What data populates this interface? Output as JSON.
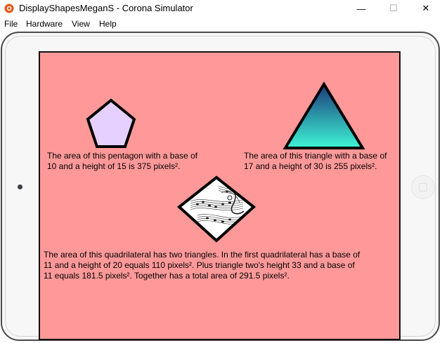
{
  "window": {
    "title": "DisplayShapesMeganS - Corona Simulator",
    "minimize_label": "—",
    "maximize_label": "☐",
    "close_label": "✕"
  },
  "menu": {
    "items": [
      "File",
      "Hardware",
      "View",
      "Help"
    ]
  },
  "screen": {
    "background_color": "#ff9999",
    "pentagon": {
      "fill": "#e6d0ff",
      "caption": "The area of this pentagon with a base of\n10 and a height of 15 is 375 pixels².",
      "base": 10,
      "height": 15,
      "area": 375
    },
    "triangle": {
      "gradient_top": "#1a3a7a",
      "gradient_bottom": "#3ef5d6",
      "caption": "The area of this triangle with a base of\n17 and a height of 30 is 255 pixels².",
      "base": 17,
      "height": 30,
      "area": 255
    },
    "quadrilateral": {
      "fill": "#ffffff",
      "image": "sheet-music",
      "caption": "The area of this quadrilateral has two triangles. In the first quadrilateral has a base of\n11 and a height of 20 equals 110 pixels². Plus triangle two's height 33 and a base of\n11 equals 181.5 pixels². Together has a total area of 291.5 pixels²."
    }
  }
}
